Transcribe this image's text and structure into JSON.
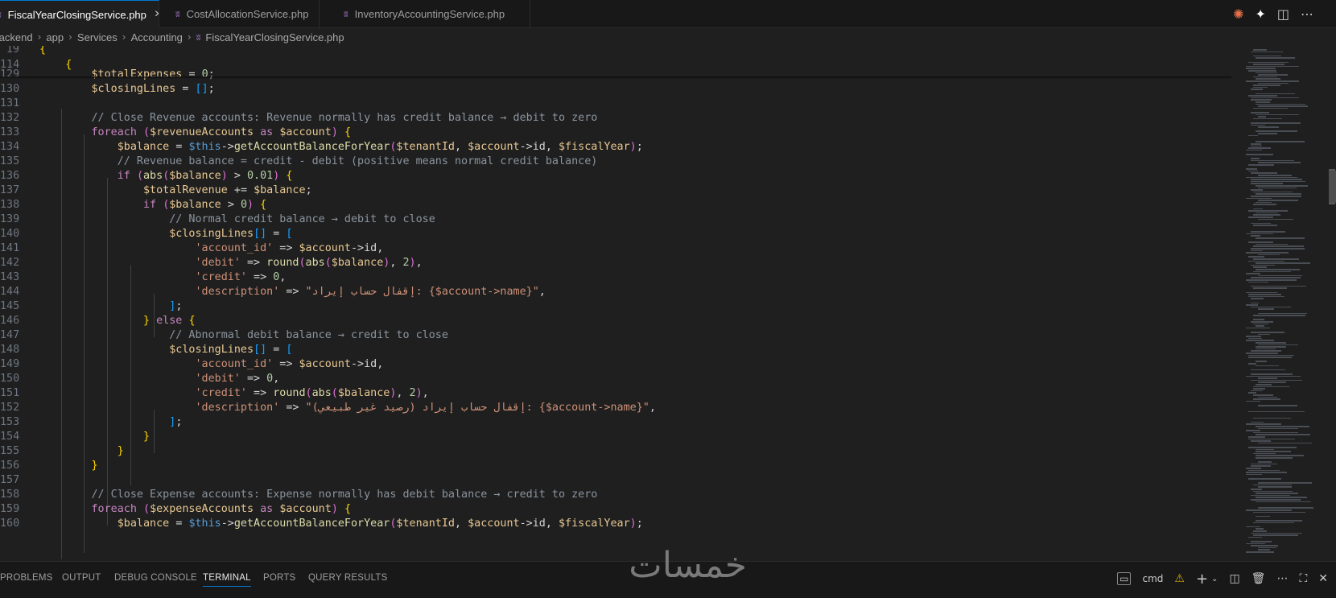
{
  "tabs": [
    {
      "label": "FiscalYearClosingService.php",
      "active": true
    },
    {
      "label": "CostAllocationService.php",
      "active": false
    },
    {
      "label": "InventoryAccountingService.php",
      "active": false
    }
  ],
  "tab_close_glyph": "×",
  "php_icon_glyph": "ʬ",
  "breadcrumb": [
    "Backend",
    "app",
    "Services",
    "Accounting",
    "FiscalYearClosingService.php"
  ],
  "breadcrumb_sep": "›",
  "editor": {
    "sticky_lines": [
      {
        "n": "19",
        "text": "{"
      },
      {
        "n": "114",
        "text": "    {"
      }
    ],
    "lines": [
      {
        "n": "129",
        "text": "        $totalExpenses = 0;"
      },
      {
        "n": "130",
        "text": "        $closingLines = [];"
      },
      {
        "n": "131",
        "text": ""
      },
      {
        "n": "132",
        "text": "        // Close Revenue accounts: Revenue normally has credit balance → debit to zero"
      },
      {
        "n": "133",
        "text": "        foreach ($revenueAccounts as $account) {"
      },
      {
        "n": "134",
        "text": "            $balance = $this->getAccountBalanceForYear($tenantId, $account->id, $fiscalYear);"
      },
      {
        "n": "135",
        "text": "            // Revenue balance = credit - debit (positive means normal credit balance)"
      },
      {
        "n": "136",
        "text": "            if (abs($balance) > 0.01) {"
      },
      {
        "n": "137",
        "text": "                $totalRevenue += $balance;"
      },
      {
        "n": "138",
        "text": "                if ($balance > 0) {"
      },
      {
        "n": "139",
        "text": "                    // Normal credit balance → debit to close"
      },
      {
        "n": "140",
        "text": "                    $closingLines[] = ["
      },
      {
        "n": "141",
        "text": "                        'account_id' => $account->id,"
      },
      {
        "n": "142",
        "text": "                        'debit' => round(abs($balance), 2),"
      },
      {
        "n": "143",
        "text": "                        'credit' => 0,"
      },
      {
        "n": "144",
        "text": "                        'description' => \"إقفال حساب إيراد: {$account->name}\","
      },
      {
        "n": "145",
        "text": "                    ];"
      },
      {
        "n": "146",
        "text": "                } else {"
      },
      {
        "n": "147",
        "text": "                    // Abnormal debit balance → credit to close"
      },
      {
        "n": "148",
        "text": "                    $closingLines[] = ["
      },
      {
        "n": "149",
        "text": "                        'account_id' => $account->id,"
      },
      {
        "n": "150",
        "text": "                        'debit' => 0,"
      },
      {
        "n": "151",
        "text": "                        'credit' => round(abs($balance), 2),"
      },
      {
        "n": "152",
        "text": "                        'description' => \"إقفال حساب إيراد (رصيد غير طبيعي): {$account->name}\","
      },
      {
        "n": "153",
        "text": "                    ];"
      },
      {
        "n": "154",
        "text": "                }"
      },
      {
        "n": "155",
        "text": "            }"
      },
      {
        "n": "156",
        "text": "        }"
      },
      {
        "n": "157",
        "text": ""
      },
      {
        "n": "158",
        "text": "        // Close Expense accounts: Expense normally has debit balance → credit to zero"
      },
      {
        "n": "159",
        "text": "        foreach ($expenseAccounts as $account) {"
      },
      {
        "n": "160",
        "text": "            $balance = $this->getAccountBalanceForYear($tenantId, $account->id, $fiscalYear);"
      }
    ]
  },
  "panel": {
    "tabs": [
      "PROBLEMS",
      "OUTPUT",
      "DEBUG CONSOLE",
      "TERMINAL",
      "PORTS",
      "QUERY RESULTS"
    ],
    "active_tab": "TERMINAL",
    "terminal_name": "cmd"
  },
  "watermark": "خمسات",
  "colors": {
    "accent": "#0078d4",
    "editor_bg": "#1f1f1f",
    "comment": "#8b949e",
    "keyword": "#c586c0",
    "variable": "#e8c892",
    "function": "#dcdcaa",
    "string": "#ce9178"
  }
}
